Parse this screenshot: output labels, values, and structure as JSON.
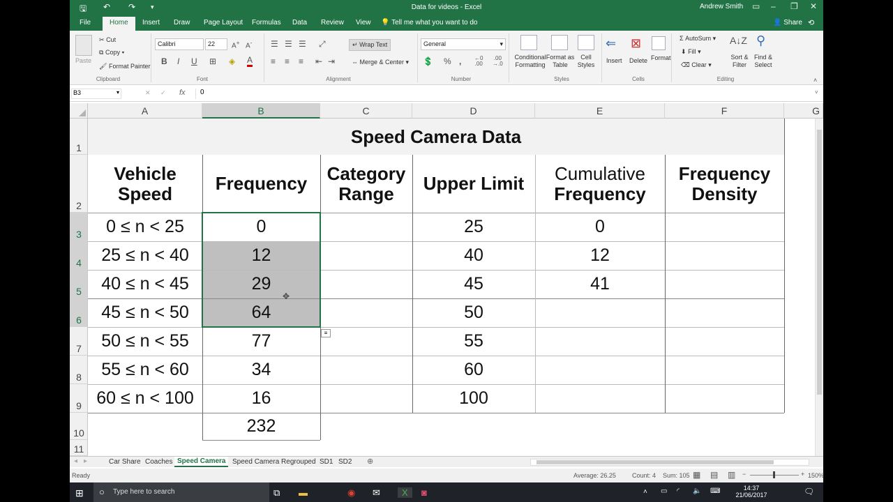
{
  "window": {
    "title": "Data for videos - Excel",
    "user": "Andrew Smith"
  },
  "tabs": [
    "File",
    "Home",
    "Insert",
    "Draw",
    "Page Layout",
    "Formulas",
    "Data",
    "Review",
    "View"
  ],
  "tell_me": "Tell me what you want to do",
  "share": "Share",
  "ribbon": {
    "paste": "Paste",
    "cut": "Cut",
    "copy": "Copy",
    "format_painter": "Format Painter",
    "clipboard": "Clipboard",
    "font_name": "Calibri",
    "font_size": "22",
    "font_group": "Font",
    "wrap_text": "Wrap Text",
    "merge_center": "Merge & Center",
    "alignment": "Alignment",
    "number_format": "General",
    "number": "Number",
    "conditional_formatting": "Conditional Formatting",
    "format_as_table": "Format as Table",
    "cell_styles": "Cell Styles",
    "styles": "Styles",
    "insert": "Insert",
    "delete": "Delete",
    "format": "Format",
    "cells": "Cells",
    "autosum": "AutoSum",
    "fill": "Fill",
    "clear": "Clear",
    "sort_filter": "Sort & Filter",
    "find_select": "Find & Select",
    "editing": "Editing"
  },
  "formula_bar": {
    "name_box": "B3",
    "fx": "fx",
    "value": "0"
  },
  "columns": [
    "A",
    "B",
    "C",
    "D",
    "E",
    "F",
    "G"
  ],
  "rows": [
    "1",
    "2",
    "3",
    "4",
    "5",
    "6",
    "7",
    "8",
    "9",
    "10",
    "11"
  ],
  "sheet": {
    "title": "Speed Camera Data",
    "headers": {
      "a1": "Vehicle",
      "a2": "Speed",
      "b": "Frequency",
      "c1": "Category",
      "c2": "Range",
      "d": "Upper Limit",
      "e1": "Cumulative",
      "e2": "Frequency",
      "f1": "Frequency",
      "f2": "Density"
    },
    "ranges": [
      "0 ≤ n < 25",
      "25 ≤ n < 40",
      "40 ≤ n < 45",
      "45 ≤ n < 50",
      "50 ≤ n < 55",
      "55 ≤ n < 60",
      "60 ≤ n < 100"
    ],
    "frequency": [
      "0",
      "12",
      "29",
      "64",
      "77",
      "34",
      "16"
    ],
    "total": "232",
    "upper_limit": [
      "25",
      "40",
      "45",
      "50",
      "55",
      "60",
      "100"
    ],
    "cumulative": [
      "0",
      "12",
      "41"
    ]
  },
  "sheet_tabs": [
    "Car Share",
    "Coaches",
    "Speed Camera",
    "Speed Camera Regrouped",
    "SD1",
    "SD2"
  ],
  "status": {
    "ready": "Ready",
    "average": "Average: 26.25",
    "count": "Count: 4",
    "sum": "Sum: 105",
    "zoom": "150%"
  },
  "taskbar": {
    "search": "Type here to search",
    "time": "14:37",
    "date": "21/06/2017"
  }
}
